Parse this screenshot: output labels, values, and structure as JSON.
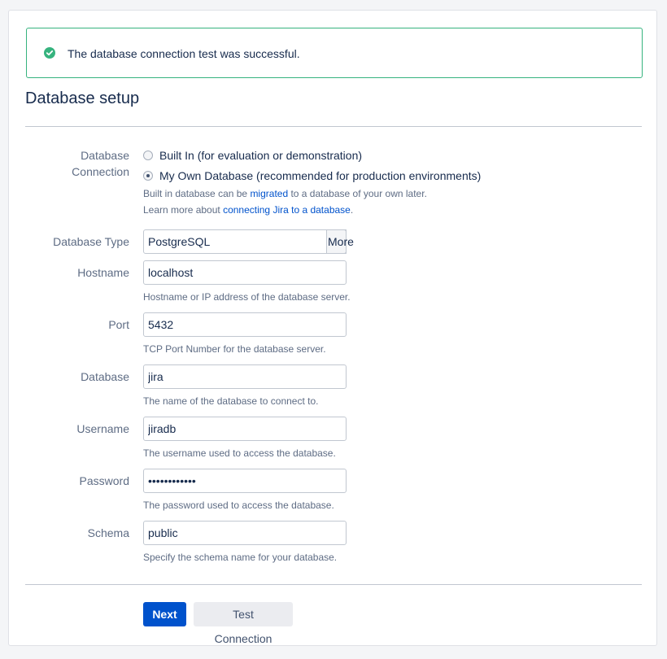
{
  "banner": {
    "icon": "check-circle-icon",
    "icon_color": "#36b37e",
    "message": "The database connection test was successful."
  },
  "page_title": "Database setup",
  "connection": {
    "label_line1": "Database",
    "label_line2": "Connection",
    "option_builtin": "Built In (for evaluation or demonstration)",
    "option_own": "My Own Database (recommended for production environments)",
    "selected": "own",
    "help1_before": "Built in database can be ",
    "help1_link": "migrated",
    "help1_after": " to a database of your own later.",
    "help2_before": "Learn more about ",
    "help2_link": "connecting Jira to a database",
    "help2_after": "."
  },
  "database_type": {
    "label": "Database Type",
    "value": "PostgreSQL",
    "more_label": "More"
  },
  "hostname": {
    "label": "Hostname",
    "value": "localhost",
    "help": "Hostname or IP address of the database server."
  },
  "port": {
    "label": "Port",
    "value": "5432",
    "help": "TCP Port Number for the database server."
  },
  "database": {
    "label": "Database",
    "value": "jira",
    "help": "The name of the database to connect to."
  },
  "username": {
    "label": "Username",
    "value": "jiradb",
    "help": "The username used to access the database."
  },
  "password": {
    "label": "Password",
    "value": "••••••••••••",
    "help": "The password used to access the database."
  },
  "schema": {
    "label": "Schema",
    "value": "public",
    "help": "Specify the schema name for your database."
  },
  "actions": {
    "next_label": "Next",
    "test_label": "Test Connection",
    "primary_color": "#0052cc"
  }
}
